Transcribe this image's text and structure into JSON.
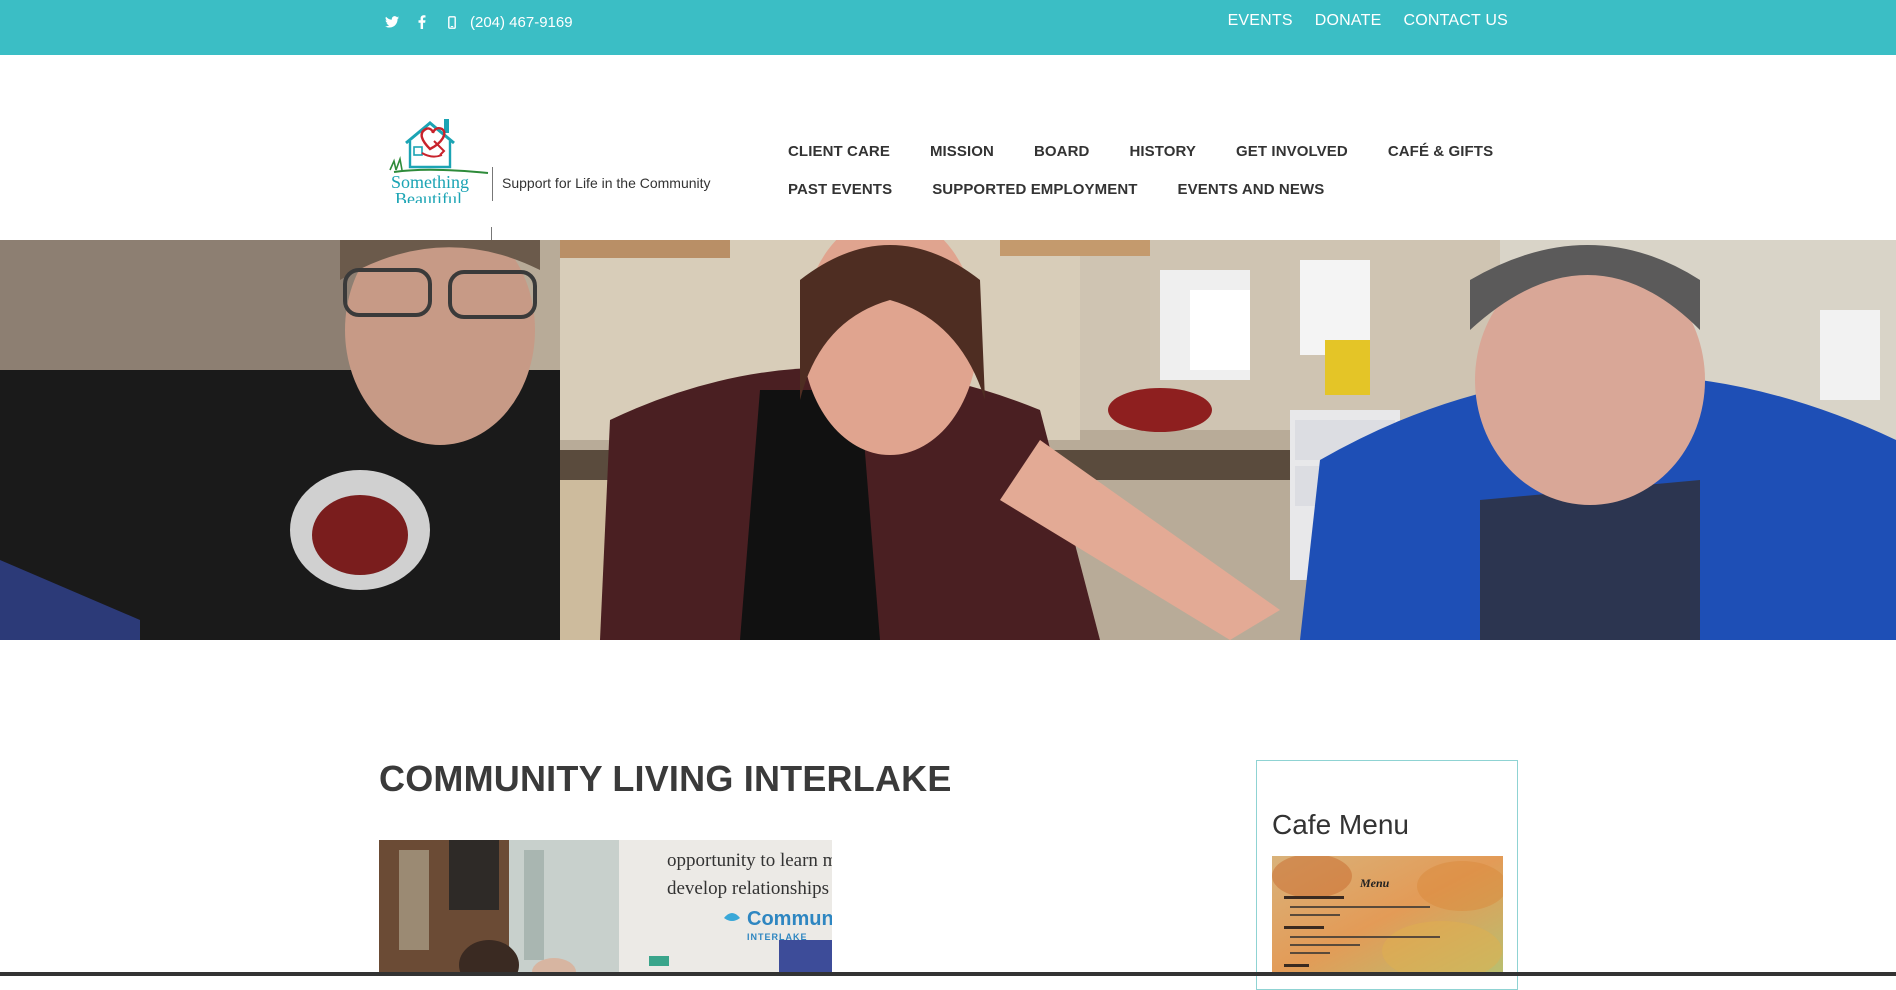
{
  "topbar": {
    "phone": "(204) 467-9169",
    "links": [
      "EVENTS",
      "DONATE",
      "CONTACT US"
    ],
    "icons": [
      "twitter-icon",
      "facebook-icon",
      "mobile-phone-icon"
    ],
    "bg_color": "#3bbec5"
  },
  "logo": {
    "brand_line1": "Something",
    "brand_line2": "Beautiful",
    "tagline": "Support for Life in the Community"
  },
  "nav": {
    "row1": [
      "CLIENT CARE",
      "MISSION",
      "BOARD",
      "HISTORY",
      "GET INVOLVED",
      "CAFÉ & GIFTS"
    ],
    "row2": [
      "PAST EVENTS",
      "SUPPORTED EMPLOYMENT",
      "EVENTS AND NEWS"
    ]
  },
  "content": {
    "title": "COMMUNITY LIVING INTERLAKE",
    "photo_text_line1": "opportunity to learn mea",
    "photo_text_line2": "develop relationships in",
    "photo_logo_text": "Communit",
    "photo_logo_sub": "INTERLAKE"
  },
  "sidebar": {
    "title": "Cafe Menu",
    "menu_heading": "Menu"
  }
}
